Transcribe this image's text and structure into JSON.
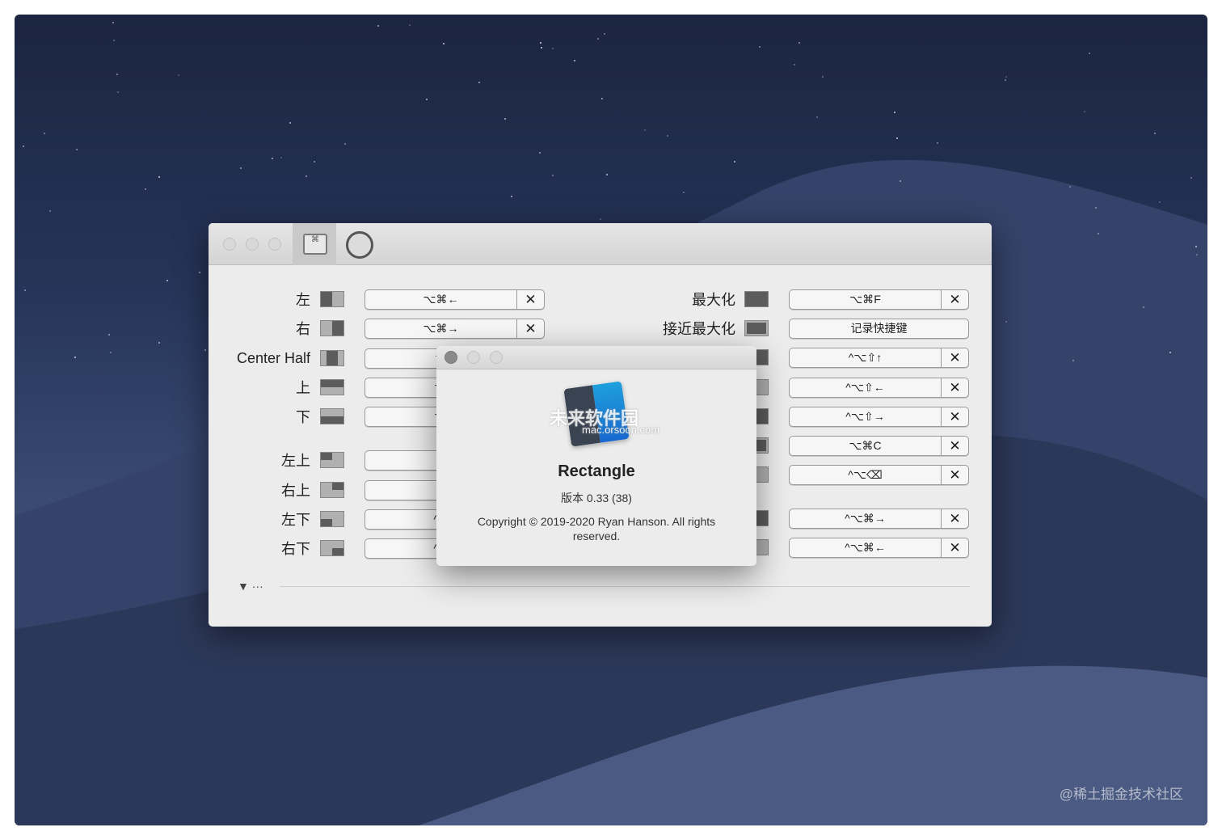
{
  "watermark": "@稀土掘金技术社区",
  "toolbar": {
    "shortcuts_tab_icon": "⌘",
    "settings_tab_icon": "gear-icon"
  },
  "left_rows": [
    {
      "label": "左",
      "shortcut": "⌥⌘←",
      "icon": "left-half"
    },
    {
      "label": "右",
      "shortcut": "⌥⌘→",
      "icon": "right-half"
    },
    {
      "label": "Center Half",
      "shortcut": "记",
      "icon": "center-half"
    },
    {
      "label": "上",
      "shortcut": "⌥",
      "icon": "top-half"
    },
    {
      "label": "下",
      "shortcut": "⌥",
      "icon": "bottom-half"
    },
    {
      "label": "左上",
      "shortcut": "^",
      "icon": "top-left"
    },
    {
      "label": "右上",
      "shortcut": "^",
      "icon": "top-right"
    },
    {
      "label": "左下",
      "shortcut": "^⇧",
      "icon": "bottom-left"
    },
    {
      "label": "右下",
      "shortcut": "^⇧",
      "icon": "bottom-right"
    }
  ],
  "right_rows": [
    {
      "label": "最大化",
      "shortcut": "⌥⌘F"
    },
    {
      "label": "接近最大化",
      "shortcut": "记录快捷键",
      "unset": true
    },
    {
      "label": "",
      "shortcut": "^⌥⇧↑"
    },
    {
      "label": "",
      "shortcut": "^⌥⇧←"
    },
    {
      "label": "",
      "shortcut": "^⌥⇧→"
    },
    {
      "label": "",
      "shortcut": "⌥⌘C"
    },
    {
      "label": "",
      "shortcut": "^⌥⌫"
    },
    {
      "label": "",
      "shortcut": "^⌥⌘→"
    },
    {
      "label": "",
      "shortcut": "^⌥⌘←"
    }
  ],
  "clear_symbol": "✕",
  "disclosure": "▼ ···",
  "about": {
    "app_name": "Rectangle",
    "version": "版本 0.33 (38)",
    "copyright": "Copyright © 2019-2020 Ryan Hanson. All rights reserved.",
    "overlay_watermark": "未来软件园",
    "overlay_watermark_url": "mac.orsoon.com"
  }
}
